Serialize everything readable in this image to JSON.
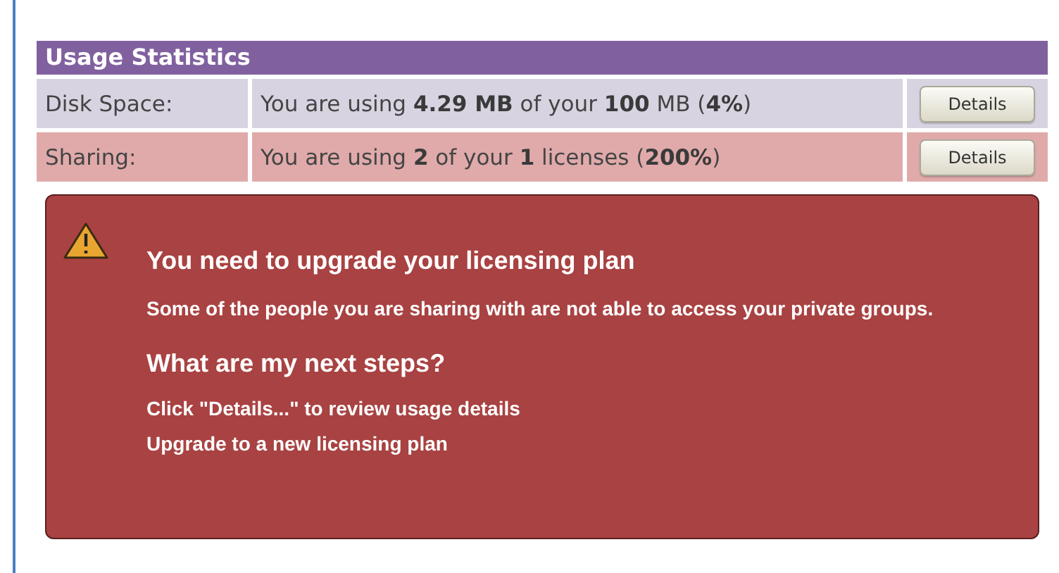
{
  "usage": {
    "title": "Usage Statistics",
    "rows": [
      {
        "label": "Disk Space:",
        "value": "You are using **4.29 MB** of your **100** MB (**4%**)",
        "button": "Details",
        "warning": false
      },
      {
        "label": "Sharing:",
        "value": "You are using **2** of your **1** licenses (**200%**)",
        "button": "Details",
        "warning": true
      }
    ]
  },
  "alert": {
    "title": "You need to upgrade your licensing plan",
    "message": "Some of the people you are sharing with are not able to access your private groups.",
    "steps_title": "What are my next steps?",
    "steps": [
      "Click \"Details...\" to review usage details",
      "Upgrade to a new licensing plan"
    ]
  }
}
